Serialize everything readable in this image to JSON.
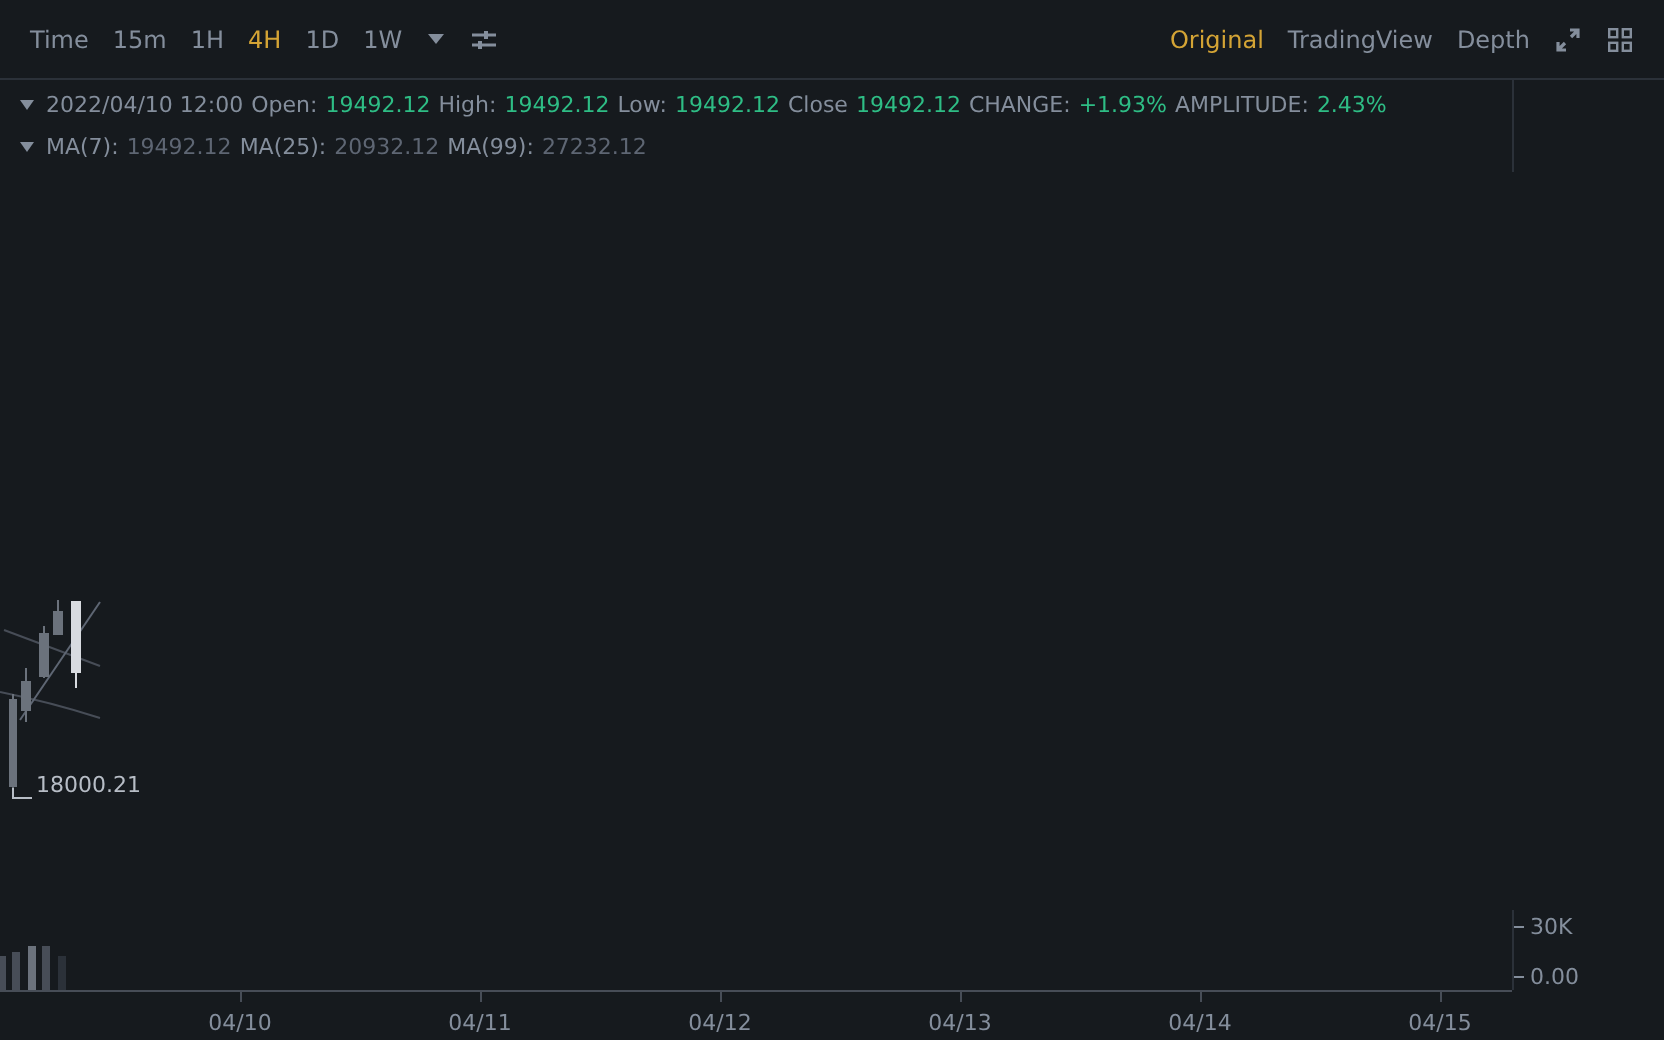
{
  "toolbar": {
    "intervals": [
      {
        "label": "Time",
        "selected": false
      },
      {
        "label": "15m",
        "selected": false
      },
      {
        "label": "1H",
        "selected": false
      },
      {
        "label": "4H",
        "selected": true
      },
      {
        "label": "1D",
        "selected": false
      },
      {
        "label": "1W",
        "selected": false
      }
    ],
    "views": [
      {
        "label": "Original",
        "selected": true
      },
      {
        "label": "TradingView",
        "selected": false
      },
      {
        "label": "Depth",
        "selected": false
      }
    ]
  },
  "candle_info": {
    "date": "2022/04/10 12:00",
    "fields": [
      {
        "label": "Open:",
        "value": "19492.12"
      },
      {
        "label": "High:",
        "value": "19492.12"
      },
      {
        "label": "Low:",
        "value": "19492.12"
      },
      {
        "label": "Close",
        "value": "19492.12"
      },
      {
        "label": "CHANGE:",
        "value": "+1.93%"
      },
      {
        "label": "AMPLITUDE:",
        "value": "2.43%"
      }
    ]
  },
  "moving_averages": [
    {
      "label": "MA(7):",
      "value": "19492.12"
    },
    {
      "label": "MA(25):",
      "value": "20932.12"
    },
    {
      "label": "MA(99):",
      "value": "27232.12"
    }
  ],
  "chart": {
    "low_label": "18000.21",
    "volume_ticks": [
      "30K",
      "0.00"
    ],
    "dates": [
      "04/10",
      "04/11",
      "04/12",
      "04/13",
      "04/14",
      "04/15"
    ]
  }
}
